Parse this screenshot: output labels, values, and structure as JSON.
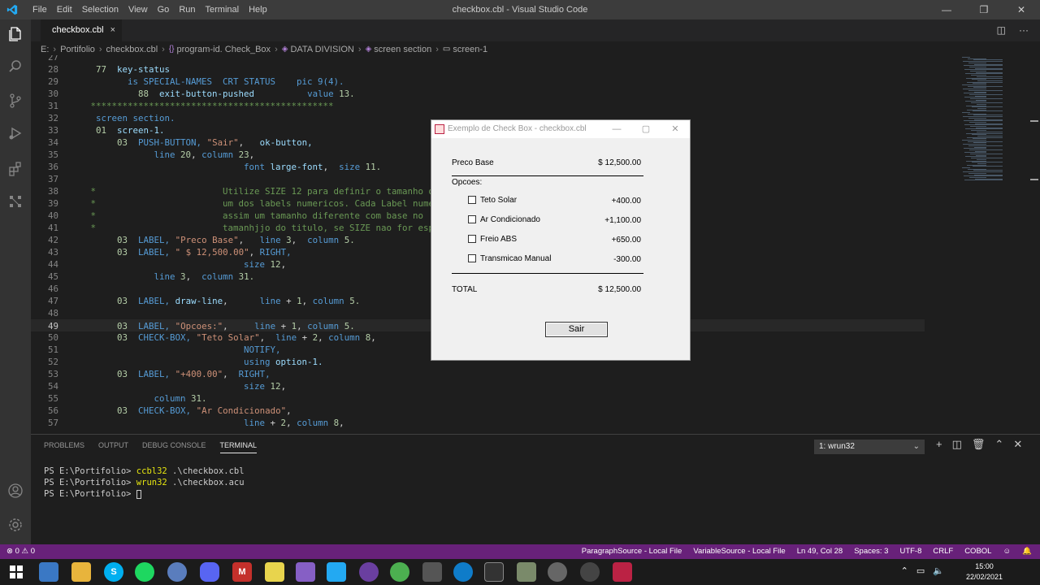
{
  "titlebar": {
    "menu": [
      "File",
      "Edit",
      "Selection",
      "View",
      "Go",
      "Run",
      "Terminal",
      "Help"
    ],
    "title": "checkbox.cbl - Visual Studio Code",
    "minimize": "—",
    "maximize": "❐",
    "close": "✕"
  },
  "activity": {
    "icons": [
      "files-icon",
      "search-icon",
      "source-control-icon",
      "run-debug-icon",
      "extensions-icon",
      "remote-explorer-icon",
      "account-icon",
      "settings-gear-icon"
    ]
  },
  "tab": {
    "label": "checkbox.cbl",
    "close": "×"
  },
  "breadcrumb": {
    "drive": "E:",
    "folder": "Portifolio",
    "file": "checkbox.cbl",
    "program": "program-id. Check_Box",
    "division": "DATA DIVISION",
    "section": "screen section",
    "screen": "screen-1"
  },
  "editor": {
    "current_line": 49,
    "lines": [
      {
        "n": "27",
        "html": ""
      },
      {
        "n": "28",
        "html": "    <span class='nm'>77</span>  <span class='id'>key-status</span>"
      },
      {
        "n": "29",
        "html": "          <span class='kw'>is SPECIAL-NAMES  CRT STATUS</span>    <span class='kw'>pic 9(4).</span>"
      },
      {
        "n": "30",
        "html": "            <span class='nm'>88</span>  <span class='id'>exit-button-pushed</span>          <span class='kw'>value</span> <span class='nm'>13.</span>"
      },
      {
        "n": "31",
        "html": "   <span class='cm'>**********************************************</span>"
      },
      {
        "n": "32",
        "html": "    <span class='kw'>screen section.</span>"
      },
      {
        "n": "33",
        "html": "    <span class='nm'>01</span>  <span class='id'>screen-1.</span>"
      },
      {
        "n": "34",
        "html": "        <span class='nm'>03</span>  <span class='kw'>PUSH-BUTTON,</span> <span class='st'>\"Sair\"</span>,   <span class='id'>ok-button,</span>"
      },
      {
        "n": "35",
        "html": "               <span class='kw'>line</span> <span class='nm'>20</span>, <span class='kw'>column</span> <span class='nm'>23</span>,"
      },
      {
        "n": "36",
        "html": "                                <span class='kw'>font</span> <span class='id'>large-font</span>,  <span class='kw'>size</span> <span class='nm'>11.</span>"
      },
      {
        "n": "37",
        "html": ""
      },
      {
        "n": "38",
        "html": "   <span class='cm'>*                        Utilize SIZE 12 para definir o tamanho d</span>"
      },
      {
        "n": "39",
        "html": "   <span class='cm'>*                        um dos labels numericos. Cada Label nume</span>"
      },
      {
        "n": "40",
        "html": "   <span class='cm'>*                        assim um tamanho diferente com base no</span>"
      },
      {
        "n": "41",
        "html": "   <span class='cm'>*                        tamanhjjo do titulo, se SIZE nao for esp</span>"
      },
      {
        "n": "42",
        "html": "        <span class='nm'>03</span>  <span class='kw'>LABEL,</span> <span class='st'>\"Preco Base\"</span>,   <span class='kw'>line</span> <span class='nm'>3</span>,  <span class='kw'>column</span> <span class='nm'>5.</span>"
      },
      {
        "n": "43",
        "html": "        <span class='nm'>03</span>  <span class='kw'>LABEL,</span> <span class='st'>\" $ 12,500.00\"</span>, <span class='kw'>RIGHT,</span>"
      },
      {
        "n": "44",
        "html": "                                <span class='kw'>size</span> <span class='nm'>12</span>,"
      },
      {
        "n": "45",
        "html": "               <span class='kw'>line</span> <span class='nm'>3</span>,  <span class='kw'>column</span> <span class='nm'>31.</span>"
      },
      {
        "n": "46",
        "html": ""
      },
      {
        "n": "47",
        "html": "        <span class='nm'>03</span>  <span class='kw'>LABEL,</span> <span class='id'>draw-line</span>,      <span class='kw'>line</span> + <span class='nm'>1</span>, <span class='kw'>column</span> <span class='nm'>5.</span>"
      },
      {
        "n": "48",
        "html": ""
      },
      {
        "n": "49",
        "html": "        <span class='nm'>03</span>  <span class='kw'>LABEL,</span> <span class='st'>\"Opcoes:\"</span>,     <span class='kw'>line</span> + <span class='nm'>1</span>, <span class='kw'>column</span> <span class='nm'>5.</span>"
      },
      {
        "n": "50",
        "html": "        <span class='nm'>03</span>  <span class='kw'>CHECK-BOX,</span> <span class='st'>\"Teto Solar\"</span>,  <span class='kw'>line</span> + <span class='nm'>2</span>, <span class='kw'>column</span> <span class='nm'>8</span>,"
      },
      {
        "n": "51",
        "html": "                                <span class='kw'>NOTIFY,</span>"
      },
      {
        "n": "52",
        "html": "                                <span class='kw'>using</span> <span class='id'>option-1.</span>"
      },
      {
        "n": "53",
        "html": "        <span class='nm'>03</span>  <span class='kw'>LABEL,</span> <span class='st'>\"+400.00\"</span>,  <span class='kw'>RIGHT,</span>"
      },
      {
        "n": "54",
        "html": "                                <span class='kw'>size</span> <span class='nm'>12</span>,"
      },
      {
        "n": "55",
        "html": "               <span class='kw'>column</span> <span class='nm'>31.</span>"
      },
      {
        "n": "56",
        "html": "        <span class='nm'>03</span>  <span class='kw'>CHECK-BOX,</span> <span class='st'>\"Ar Condicionado\"</span>,"
      },
      {
        "n": "57",
        "html": "                                <span class='kw'>line</span> + <span class='nm'>2</span>, <span class='kw'>column</span> <span class='nm'>8</span>,"
      }
    ]
  },
  "panel": {
    "tabs": [
      "PROBLEMS",
      "OUTPUT",
      "DEBUG CONSOLE",
      "TERMINAL"
    ],
    "active_tab": "TERMINAL",
    "terminal_select": "1: wrun32",
    "terminal": [
      {
        "prompt": "PS E:\\Portifolio> ",
        "cmd": "ccbl32",
        "args": " .\\checkbox.cbl"
      },
      {
        "prompt": "PS E:\\Portifolio> ",
        "cmd": "wrun32",
        "args": " .\\checkbox.acu"
      },
      {
        "prompt": "PS E:\\Portifolio> ",
        "cmd": "",
        "args": ""
      }
    ]
  },
  "statusbar": {
    "errors": "0",
    "warnings": "0",
    "items": [
      "ParagraphSource - Local File",
      "VariableSource - Local File",
      "Ln 49, Col 28",
      "Spaces: 3",
      "UTF-8",
      "CRLF",
      "COBOL"
    ]
  },
  "taskbar": {
    "time": "15:00",
    "date": "22/02/2021"
  },
  "dialog": {
    "title": "Exemplo de Check Box - checkbox.cbl",
    "base_label": "Preco Base",
    "base_value": "$ 12,500.00",
    "options_label": "Opcoes:",
    "options": [
      {
        "label": "Teto Solar",
        "value": "+400.00",
        "checked": false
      },
      {
        "label": "Ar Condicionado",
        "value": "+1,100.00",
        "checked": false
      },
      {
        "label": "Freio ABS",
        "value": "+650.00",
        "checked": false
      },
      {
        "label": "Transmicao Manual",
        "value": "-300.00",
        "checked": false
      }
    ],
    "total_label": "TOTAL",
    "total_value": "$ 12,500.00",
    "button": "Sair"
  },
  "colors": {
    "statusbar": "#68217a",
    "editor_bg": "#1e1e1e",
    "activitybar": "#333333"
  }
}
